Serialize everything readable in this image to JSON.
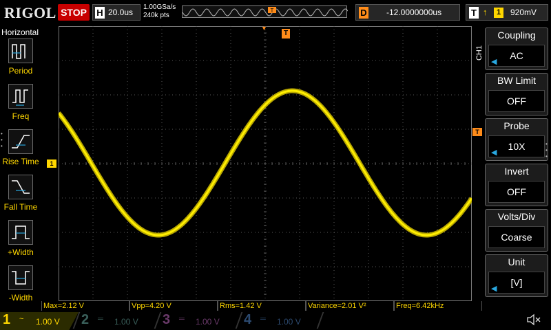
{
  "colors": {
    "ch1": "#ffd700",
    "trigger": "#ff8c1a",
    "stop": "#c80000",
    "grid": "#5a5a5a",
    "arrow": "#29a8e0"
  },
  "topbar": {
    "brand": "RIGOL",
    "run_state": "STOP",
    "horizontal_label": "H",
    "timebase": "20.0us",
    "sample_rate": "1.00GSa/s",
    "memory_depth": "240k pts",
    "memory_trigger_marker": "T",
    "delay_label": "D",
    "delay": "-12.0000000us",
    "trigger_label": "T",
    "trigger_edge_icon": "rising-edge-icon",
    "trigger_edge_glyph": "↑",
    "trigger_source": "1",
    "trigger_level": "920mV"
  },
  "left_menu": {
    "title": "Horizontal",
    "items": [
      {
        "label": "Period",
        "icon": "period-icon"
      },
      {
        "label": "Freq",
        "icon": "frequency-icon"
      },
      {
        "label": "Rise Time",
        "icon": "rise-time-icon"
      },
      {
        "label": "Fall Time",
        "icon": "fall-time-icon"
      },
      {
        "label": "+Width",
        "icon": "positive-width-icon"
      },
      {
        "label": "-Width",
        "icon": "negative-width-icon"
      }
    ]
  },
  "screen": {
    "trigger_marker": "T",
    "ch1_marker": "1",
    "trigger_level_marker": "T",
    "waveform": {
      "type": "sine",
      "channel": "CH1",
      "max_v": 2.12,
      "min_v": -2.08,
      "center_div": 0,
      "volts_per_div": 1.0,
      "period_us": 155.8,
      "peak_time_us": [
        -140,
        16
      ]
    }
  },
  "right_menu": {
    "channel_tag": "CH1",
    "items": [
      {
        "title": "Coupling",
        "value": "AC",
        "has_arrow": true
      },
      {
        "title": "BW Limit",
        "value": "OFF",
        "has_arrow": false
      },
      {
        "title": "Probe",
        "value": "10X",
        "has_arrow": true
      },
      {
        "title": "Invert",
        "value": "OFF",
        "has_arrow": false
      },
      {
        "title": "Volts/Div",
        "value": "Coarse",
        "has_arrow": false
      },
      {
        "title": "Unit",
        "value": "[V]",
        "has_arrow": true
      }
    ]
  },
  "measurements": [
    {
      "text": "Max=2.12 V"
    },
    {
      "text": "Vpp=4.20 V"
    },
    {
      "text": "Rms=1.42 V"
    },
    {
      "text": "Variance=2.01 V²"
    },
    {
      "text": "Freq=6.42kHz"
    }
  ],
  "channels": [
    {
      "num": "1",
      "coupling": "~",
      "scale": "1.00 V"
    },
    {
      "num": "2",
      "coupling": "═",
      "scale": "1.00 V"
    },
    {
      "num": "3",
      "coupling": "═",
      "scale": "1.00 V"
    },
    {
      "num": "4",
      "coupling": "═",
      "scale": "1.00 V"
    }
  ],
  "icons": {
    "sound": "speaker-muted-icon"
  }
}
